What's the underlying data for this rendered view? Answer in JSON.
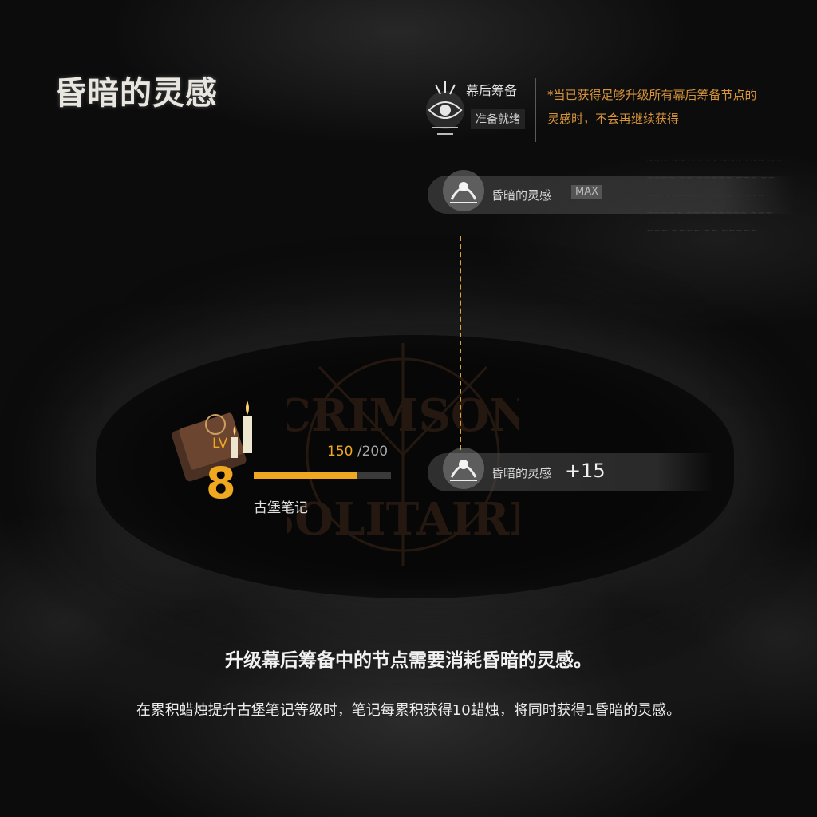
{
  "title": "昏暗的灵感",
  "prepare": {
    "name": "幕后筹备",
    "status": "准备就绪",
    "note": "*当已获得足够升级所有幕后筹备节点的灵感时，不会再继续获得"
  },
  "nodes": [
    {
      "label": "昏暗的灵感",
      "badge": "MAX"
    },
    {
      "label": "昏暗的灵感",
      "value": "+15"
    }
  ],
  "notebook": {
    "lv_label": "LV",
    "level": "8",
    "progress_current": "150",
    "progress_max": "/200",
    "progress_fraction": 0.75,
    "name": "古堡笔记"
  },
  "description": {
    "line1": "升级幕后筹备中的节点需要消耗昏暗的灵感。",
    "line2": "在累积蜡烛提升古堡笔记等级时，笔记每累积获得10蜡烛，将同时获得1昏暗的灵感。"
  },
  "colors": {
    "accent": "#f0a820",
    "note": "#d7943b"
  }
}
